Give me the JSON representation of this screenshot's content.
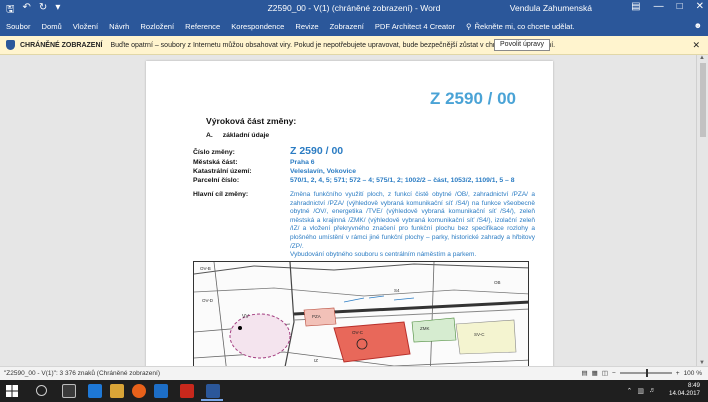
{
  "titlebar": {
    "title": "Z2590_00 - V(1) (chráněné zobrazení) - Word",
    "user": "Vendula Zahumenská",
    "qat": [
      "save-icon",
      "undo-icon",
      "redo-icon"
    ]
  },
  "ribbon": {
    "tabs": [
      "Soubor",
      "Domů",
      "Vložení",
      "Návrh",
      "Rozložení",
      "Reference",
      "Korespondence",
      "Revize",
      "Zobrazení",
      "PDF Architect 4 Creator"
    ],
    "tell_me": "Řekněte mi, co chcete udělat."
  },
  "message_bar": {
    "label": "CHRÁNĚNÉ ZOBRAZENÍ",
    "text": "Buďte opatrní – soubory z Internetu můžou obsahovat viry. Pokud je nepotřebujete upravovat, bude bezpečnější zůstat v chráněném zobrazení.",
    "button": "Povolit úpravy"
  },
  "document": {
    "big_id": "Z 2590 / 00",
    "heading": "Výroková část změny:",
    "sub_letter": "A.",
    "sub_text": "základní údaje",
    "fields": [
      {
        "label": "Číslo změny:",
        "value": "Z 2590 / 00"
      },
      {
        "label": "Městská část:",
        "value": "Praha 6"
      },
      {
        "label": "Katastrální území:",
        "value": "Veleslavín, Vokovice"
      },
      {
        "label": "Parcelní číslo:",
        "value": "570/1, 2, 4, 5; 571; 572 – 4; 575/1, 2; 1002/2 – část, 1053/2, 1109/1, 5 – 8"
      }
    ],
    "goal_label": "Hlavní cíl změny:",
    "goal_text": "Změna funkčního využití ploch, z funkcí čistě obytné /OB/, zahradnictví /PZA/ a zahradnictví /PZA/ (výhledově vybraná komunikační síť /S4/) na funkce všeobecně obytné /OV/, energetika /TVE/ (výhledově vybraná komunikační síť /S4/), zeleň městská a krajinná /ZMK/ (výhledově vybraná komunikační síť /S4/), izolační zeleň /IZ/ a vložení překryvného značení pro funkční plochu bez specifikace rozlohy a plošného umístění v rámci jiné funkční plochy – parky, historické zahrady a hřbitovy /ZP/.",
    "goal_text2": "Vybudování obytného souboru s centrálním náměstím a parkem.",
    "map_labels": [
      "OV-B",
      "VV",
      "OV-C",
      "ZMK",
      "S4",
      "OV-D",
      "SV-C",
      "OB",
      "PZA",
      "IZ"
    ]
  },
  "statusbar": {
    "text": "\"Z2590_00 - V(1)\": 3 376 znaků (Chráněné zobrazení)",
    "zoom": "100 %"
  },
  "taskbar": {
    "time": "8:49",
    "date": "14.04.2017"
  }
}
